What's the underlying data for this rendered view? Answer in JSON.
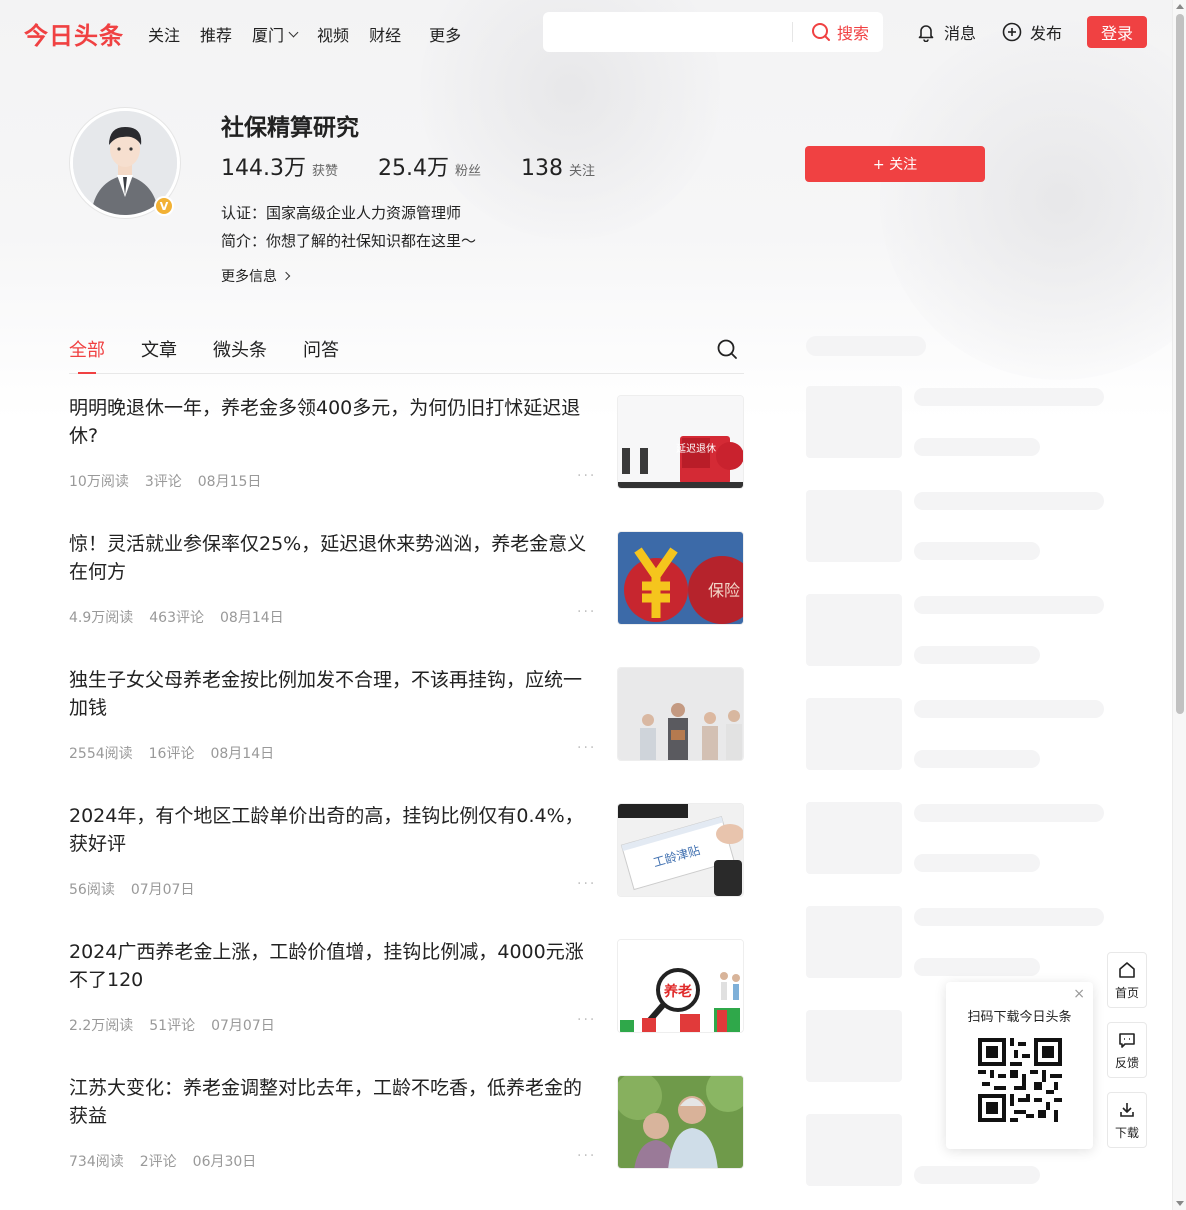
{
  "brand": {
    "logo": "今日头条",
    "accent": "#f04142"
  },
  "nav": {
    "links": [
      "关注",
      "推荐",
      "厦门",
      "视频",
      "财经"
    ],
    "more": "更多",
    "search_placeholder": "",
    "search_label": "搜索",
    "messages": "消息",
    "publish": "发布",
    "login": "登录"
  },
  "profile": {
    "name": "社保精算研究",
    "likes_num": "144.3万",
    "likes_label": "获赞",
    "fans_num": "25.4万",
    "fans_label": "粉丝",
    "following_num": "138",
    "following_label": "关注",
    "certification": "认证：国家高级企业人力资源管理师",
    "bio": "简介：你想了解的社保知识都在这里～",
    "more_info": "更多信息",
    "follow_button": "+ 关注",
    "badge": "V"
  },
  "tabs": [
    "全部",
    "文章",
    "微头条",
    "问答"
  ],
  "articles": [
    {
      "title": "明明晚退休一年，养老金多领400多元，为何仍旧打怵延迟退休?",
      "reads": "10万阅读",
      "comments": "3评论",
      "date": "08月15日",
      "thumb_text": "延迟退休"
    },
    {
      "title": "惊！灵活就业参保率仅25%，延迟退休来势汹汹，养老金意义在何方",
      "reads": "4.9万阅读",
      "comments": "463评论",
      "date": "08月14日",
      "thumb_text": "保险"
    },
    {
      "title": "独生子女父母养老金按比例加发不合理，不该再挂钩，应统一加钱",
      "reads": "2554阅读",
      "comments": "16评论",
      "date": "08月14日",
      "thumb_text": ""
    },
    {
      "title": "2024年，有个地区工龄单价出奇的高，挂钩比例仅有0.4%，获好评",
      "reads": "56阅读",
      "comments": "",
      "date": "07月07日",
      "thumb_text": "工龄津贴"
    },
    {
      "title": "2024广西养老金上涨，工龄价值增，挂钩比例减，4000元涨不了120",
      "reads": "2.2万阅读",
      "comments": "51评论",
      "date": "07月07日",
      "thumb_text": "养老"
    },
    {
      "title": "江苏大变化：养老金调整对比去年，工龄不吃香，低养老金的获益",
      "reads": "734阅读",
      "comments": "2评论",
      "date": "06月30日",
      "thumb_text": ""
    }
  ],
  "qr": {
    "title": "扫码下载今日头条",
    "close": "×"
  },
  "side": {
    "home": "首页",
    "feedback": "反馈",
    "download": "下载"
  },
  "icons": {
    "search": "search-icon",
    "bell": "bell-icon",
    "plus": "plus-circle-icon",
    "home": "home-icon",
    "feedback": "chat-bubble-icon",
    "download": "download-icon"
  }
}
